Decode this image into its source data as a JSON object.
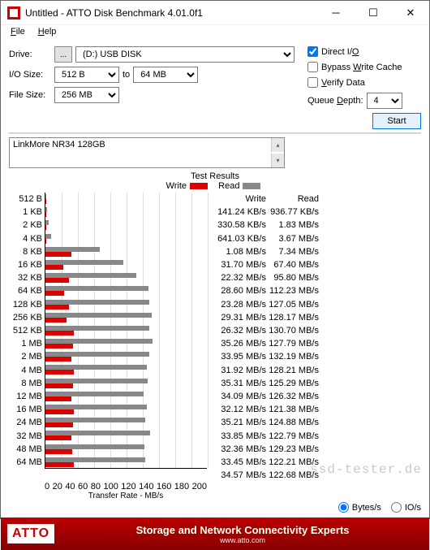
{
  "window": {
    "title": "Untitled - ATTO Disk Benchmark 4.01.0f1"
  },
  "menu": {
    "file": "File",
    "help": "Help"
  },
  "labels": {
    "drive": "Drive:",
    "iosize": "I/O Size:",
    "to": "to",
    "filesize": "File Size:",
    "queuedepth": "Queue Depth:",
    "testresults": "Test Results",
    "write": "Write",
    "read": "Read",
    "xaxis": "Transfer Rate - MB/s"
  },
  "drive": {
    "value": "(D:) USB DISK"
  },
  "iosize": {
    "from": "512 B",
    "to": "64 MB"
  },
  "filesize": {
    "value": "256 MB"
  },
  "queuedepth": {
    "value": "4"
  },
  "checks": {
    "directio": "Direct I/O",
    "bypass": "Bypass Write Cache",
    "verify": "Verify Data"
  },
  "buttons": {
    "start": "Start",
    "browse": "..."
  },
  "testname": "LinkMore NR34 128GB",
  "units": {
    "bytes": "Bytes/s",
    "ios": "IO/s"
  },
  "watermark": "ssd-tester.de",
  "footer": {
    "logo": "ATTO",
    "line1": "Storage and Network Connectivity Experts",
    "line2": "www.atto.com"
  },
  "xticks": [
    "0",
    "20",
    "40",
    "60",
    "80",
    "100",
    "120",
    "140",
    "160",
    "180",
    "200"
  ],
  "chart_data": {
    "type": "bar",
    "xlabel": "Transfer Rate - MB/s",
    "xlim": [
      0,
      200
    ],
    "categories": [
      "512 B",
      "1 KB",
      "2 KB",
      "4 KB",
      "8 KB",
      "16 KB",
      "32 KB",
      "64 KB",
      "128 KB",
      "256 KB",
      "512 KB",
      "1 MB",
      "2 MB",
      "4 MB",
      "8 MB",
      "12 MB",
      "16 MB",
      "24 MB",
      "32 MB",
      "48 MB",
      "64 MB"
    ],
    "series": [
      {
        "name": "Write",
        "unit_labels": [
          "141.24 KB/s",
          "330.58 KB/s",
          "641.03 KB/s",
          "1.08 MB/s",
          "31.70 MB/s",
          "22.32 MB/s",
          "28.60 MB/s",
          "23.28 MB/s",
          "29.31 MB/s",
          "26.32 MB/s",
          "35.26 MB/s",
          "33.95 MB/s",
          "31.92 MB/s",
          "35.31 MB/s",
          "34.09 MB/s",
          "32.12 MB/s",
          "35.21 MB/s",
          "33.85 MB/s",
          "32.36 MB/s",
          "33.45 MB/s",
          "34.57 MB/s"
        ],
        "values_mb": [
          0.14,
          0.33,
          0.64,
          1.08,
          31.7,
          22.32,
          28.6,
          23.28,
          29.31,
          26.32,
          35.26,
          33.95,
          31.92,
          35.31,
          34.09,
          32.12,
          35.21,
          33.85,
          32.36,
          33.45,
          34.57
        ]
      },
      {
        "name": "Read",
        "unit_labels": [
          "936.77 KB/s",
          "1.83 MB/s",
          "3.67 MB/s",
          "7.34 MB/s",
          "67.40 MB/s",
          "95.80 MB/s",
          "112.23 MB/s",
          "127.05 MB/s",
          "128.17 MB/s",
          "130.70 MB/s",
          "127.79 MB/s",
          "132.19 MB/s",
          "128.21 MB/s",
          "125.29 MB/s",
          "126.32 MB/s",
          "121.38 MB/s",
          "124.88 MB/s",
          "122.79 MB/s",
          "129.23 MB/s",
          "122.21 MB/s",
          "122.68 MB/s"
        ],
        "values_mb": [
          0.94,
          1.83,
          3.67,
          7.34,
          67.4,
          95.8,
          112.23,
          127.05,
          128.17,
          130.7,
          127.79,
          132.19,
          128.21,
          125.29,
          126.32,
          121.38,
          124.88,
          122.79,
          129.23,
          122.21,
          122.68
        ]
      }
    ]
  }
}
